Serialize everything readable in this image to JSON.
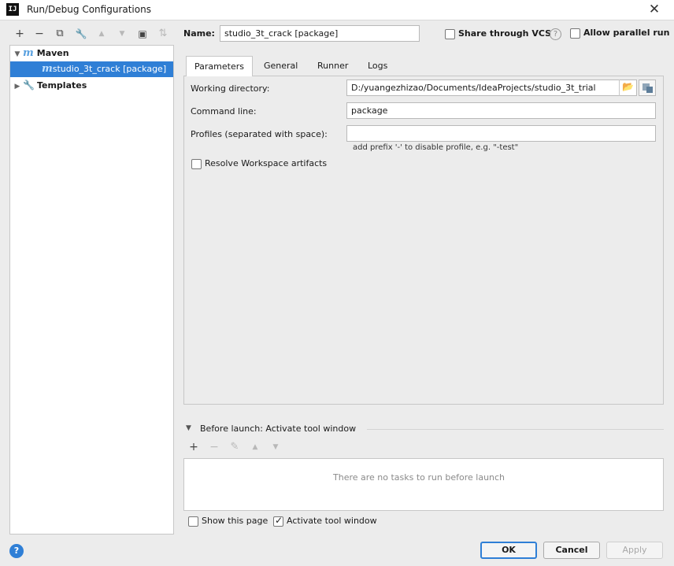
{
  "window": {
    "title": "Run/Debug Configurations",
    "app_icon_label": "IJ"
  },
  "toolbar": {
    "add": "+",
    "remove": "−",
    "copy": "⧉",
    "wrench": "🔧",
    "up": "▲",
    "down": "▼",
    "new_folder": "▣",
    "sort": "⇅"
  },
  "tree": {
    "maven": {
      "icon_letter": "m",
      "label": "Maven"
    },
    "selected_item": {
      "icon_letter": "m",
      "label": "studio_3t_crack [package]"
    },
    "templates": {
      "label": "Templates"
    }
  },
  "name_row": {
    "label": "Name:",
    "value": "studio_3t_crack [package]",
    "share_label": "Share through VCS",
    "help": "?",
    "parallel_label": "Allow parallel run"
  },
  "tabs": [
    "Parameters",
    "General",
    "Runner",
    "Logs"
  ],
  "parameters": {
    "working_directory_label": "Working directory:",
    "working_directory_value": "D:/yuangezhizao/Documents/IdeaProjects/studio_3t_trial",
    "command_line_label": "Command line:",
    "command_line_value": "package",
    "profiles_label": "Profiles (separated with space):",
    "profiles_value": "",
    "profiles_hint": "add prefix '-' to disable profile, e.g. \"-test\"",
    "resolve_workspace_label": "Resolve Workspace artifacts"
  },
  "before_launch": {
    "header": "Before launch: Activate tool window",
    "toolbar": {
      "add": "+",
      "remove": "−",
      "edit": "✎",
      "up": "▲",
      "down": "▼"
    },
    "empty_text": "There are no tasks to run before launch",
    "show_page_label": "Show this page",
    "activate_label": "Activate tool window"
  },
  "buttons": {
    "help": "?",
    "ok": "OK",
    "cancel": "Cancel",
    "apply": "Apply"
  },
  "colors": {
    "accent": "#2f7fd6",
    "maven_icon": "#5aa1e0"
  }
}
